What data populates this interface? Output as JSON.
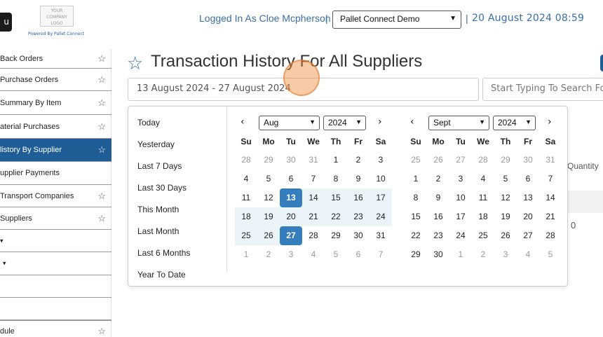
{
  "header": {
    "menu_label": "u",
    "logo_lines": [
      "YOUR",
      "COMPANY",
      "LOGO"
    ],
    "powered_by": "Powered By Pallet Connect",
    "logged_in": "Logged In As Cloe Mcpherson",
    "separator": "|",
    "company_selected": "Pallet Connect Demo",
    "datetime": "20 August 2024 08:59"
  },
  "sidebar": {
    "items": [
      {
        "label": "Back Orders",
        "star": "☆"
      },
      {
        "label": "Purchase Orders",
        "star": "☆"
      },
      {
        "label": "Summary By Item",
        "star": "☆"
      },
      {
        "label": "aterial Purchases",
        "star": "☆"
      },
      {
        "label": "listory By Supplier",
        "star": "☆"
      },
      {
        "label": "upplier Payments",
        "star": ""
      },
      {
        "label": "Transport Companies",
        "star": "☆"
      },
      {
        "label": "Suppliers",
        "star": "☆"
      },
      {
        "label": "▾",
        "star": ""
      },
      {
        "label": "▾",
        "star": ""
      },
      {
        "label": "",
        "star": ""
      },
      {
        "label": "",
        "star": ""
      },
      {
        "label": "dule",
        "star": "☆"
      }
    ]
  },
  "main": {
    "title": "Transaction History For All Suppliers",
    "date_range_value": "13 August 2024 - 27 August 2024",
    "search_placeholder": "Start Typing To Search For",
    "bg_column_header": "Quantity",
    "bg_cell_value": "0"
  },
  "picker": {
    "ranges": [
      "Today",
      "Yesterday",
      "Last 7 Days",
      "Last 30 Days",
      "This Month",
      "Last Month",
      "Last 6 Months",
      "Year To Date"
    ],
    "weekdays": [
      "Su",
      "Mo",
      "Tu",
      "We",
      "Th",
      "Fr",
      "Sa"
    ],
    "left": {
      "month": "Aug",
      "year": "2024",
      "prev_icon": "‹",
      "next_icon": "›",
      "weeks": [
        [
          {
            "d": "28",
            "s": "off"
          },
          {
            "d": "29",
            "s": "off"
          },
          {
            "d": "30",
            "s": "off"
          },
          {
            "d": "31",
            "s": "off"
          },
          {
            "d": "1",
            "s": ""
          },
          {
            "d": "2",
            "s": ""
          },
          {
            "d": "3",
            "s": ""
          }
        ],
        [
          {
            "d": "4",
            "s": ""
          },
          {
            "d": "5",
            "s": ""
          },
          {
            "d": "6",
            "s": ""
          },
          {
            "d": "7",
            "s": ""
          },
          {
            "d": "8",
            "s": ""
          },
          {
            "d": "9",
            "s": ""
          },
          {
            "d": "10",
            "s": ""
          }
        ],
        [
          {
            "d": "11",
            "s": ""
          },
          {
            "d": "12",
            "s": ""
          },
          {
            "d": "13",
            "s": "active"
          },
          {
            "d": "14",
            "s": "inrange"
          },
          {
            "d": "15",
            "s": "inrange"
          },
          {
            "d": "16",
            "s": "inrange"
          },
          {
            "d": "17",
            "s": "inrange"
          }
        ],
        [
          {
            "d": "18",
            "s": "inrange"
          },
          {
            "d": "19",
            "s": "inrange"
          },
          {
            "d": "20",
            "s": "inrange"
          },
          {
            "d": "21",
            "s": "inrange"
          },
          {
            "d": "22",
            "s": "inrange"
          },
          {
            "d": "23",
            "s": "inrange"
          },
          {
            "d": "24",
            "s": "inrange"
          }
        ],
        [
          {
            "d": "25",
            "s": "inrange"
          },
          {
            "d": "26",
            "s": "inrange"
          },
          {
            "d": "27",
            "s": "active"
          },
          {
            "d": "28",
            "s": ""
          },
          {
            "d": "29",
            "s": ""
          },
          {
            "d": "30",
            "s": ""
          },
          {
            "d": "31",
            "s": ""
          }
        ],
        [
          {
            "d": "1",
            "s": "off"
          },
          {
            "d": "2",
            "s": "off"
          },
          {
            "d": "3",
            "s": "off"
          },
          {
            "d": "4",
            "s": "off"
          },
          {
            "d": "5",
            "s": "off"
          },
          {
            "d": "6",
            "s": "off"
          },
          {
            "d": "7",
            "s": "off"
          }
        ]
      ]
    },
    "right": {
      "month": "Sept",
      "year": "2024",
      "prev_icon": "‹",
      "next_icon": "›",
      "weeks": [
        [
          {
            "d": "25",
            "s": "off"
          },
          {
            "d": "26",
            "s": "off"
          },
          {
            "d": "27",
            "s": "off"
          },
          {
            "d": "28",
            "s": "off"
          },
          {
            "d": "29",
            "s": "off"
          },
          {
            "d": "30",
            "s": "off"
          },
          {
            "d": "31",
            "s": "off"
          }
        ],
        [
          {
            "d": "1",
            "s": ""
          },
          {
            "d": "2",
            "s": ""
          },
          {
            "d": "3",
            "s": ""
          },
          {
            "d": "4",
            "s": ""
          },
          {
            "d": "5",
            "s": ""
          },
          {
            "d": "6",
            "s": ""
          },
          {
            "d": "7",
            "s": ""
          }
        ],
        [
          {
            "d": "8",
            "s": ""
          },
          {
            "d": "9",
            "s": ""
          },
          {
            "d": "10",
            "s": ""
          },
          {
            "d": "11",
            "s": ""
          },
          {
            "d": "12",
            "s": ""
          },
          {
            "d": "13",
            "s": ""
          },
          {
            "d": "14",
            "s": ""
          }
        ],
        [
          {
            "d": "15",
            "s": ""
          },
          {
            "d": "16",
            "s": ""
          },
          {
            "d": "17",
            "s": ""
          },
          {
            "d": "18",
            "s": ""
          },
          {
            "d": "19",
            "s": ""
          },
          {
            "d": "20",
            "s": ""
          },
          {
            "d": "21",
            "s": ""
          }
        ],
        [
          {
            "d": "22",
            "s": ""
          },
          {
            "d": "23",
            "s": ""
          },
          {
            "d": "24",
            "s": ""
          },
          {
            "d": "25",
            "s": ""
          },
          {
            "d": "26",
            "s": ""
          },
          {
            "d": "27",
            "s": ""
          },
          {
            "d": "28",
            "s": ""
          }
        ],
        [
          {
            "d": "29",
            "s": ""
          },
          {
            "d": "30",
            "s": ""
          },
          {
            "d": "1",
            "s": "off"
          },
          {
            "d": "2",
            "s": "off"
          },
          {
            "d": "3",
            "s": "off"
          },
          {
            "d": "4",
            "s": "off"
          },
          {
            "d": "5",
            "s": "off"
          }
        ]
      ]
    }
  },
  "colors": {
    "accent": "#1f5d97",
    "active_day": "#357ebd",
    "range_bg": "#ebf4f8",
    "header_text": "#3a6ea5"
  }
}
